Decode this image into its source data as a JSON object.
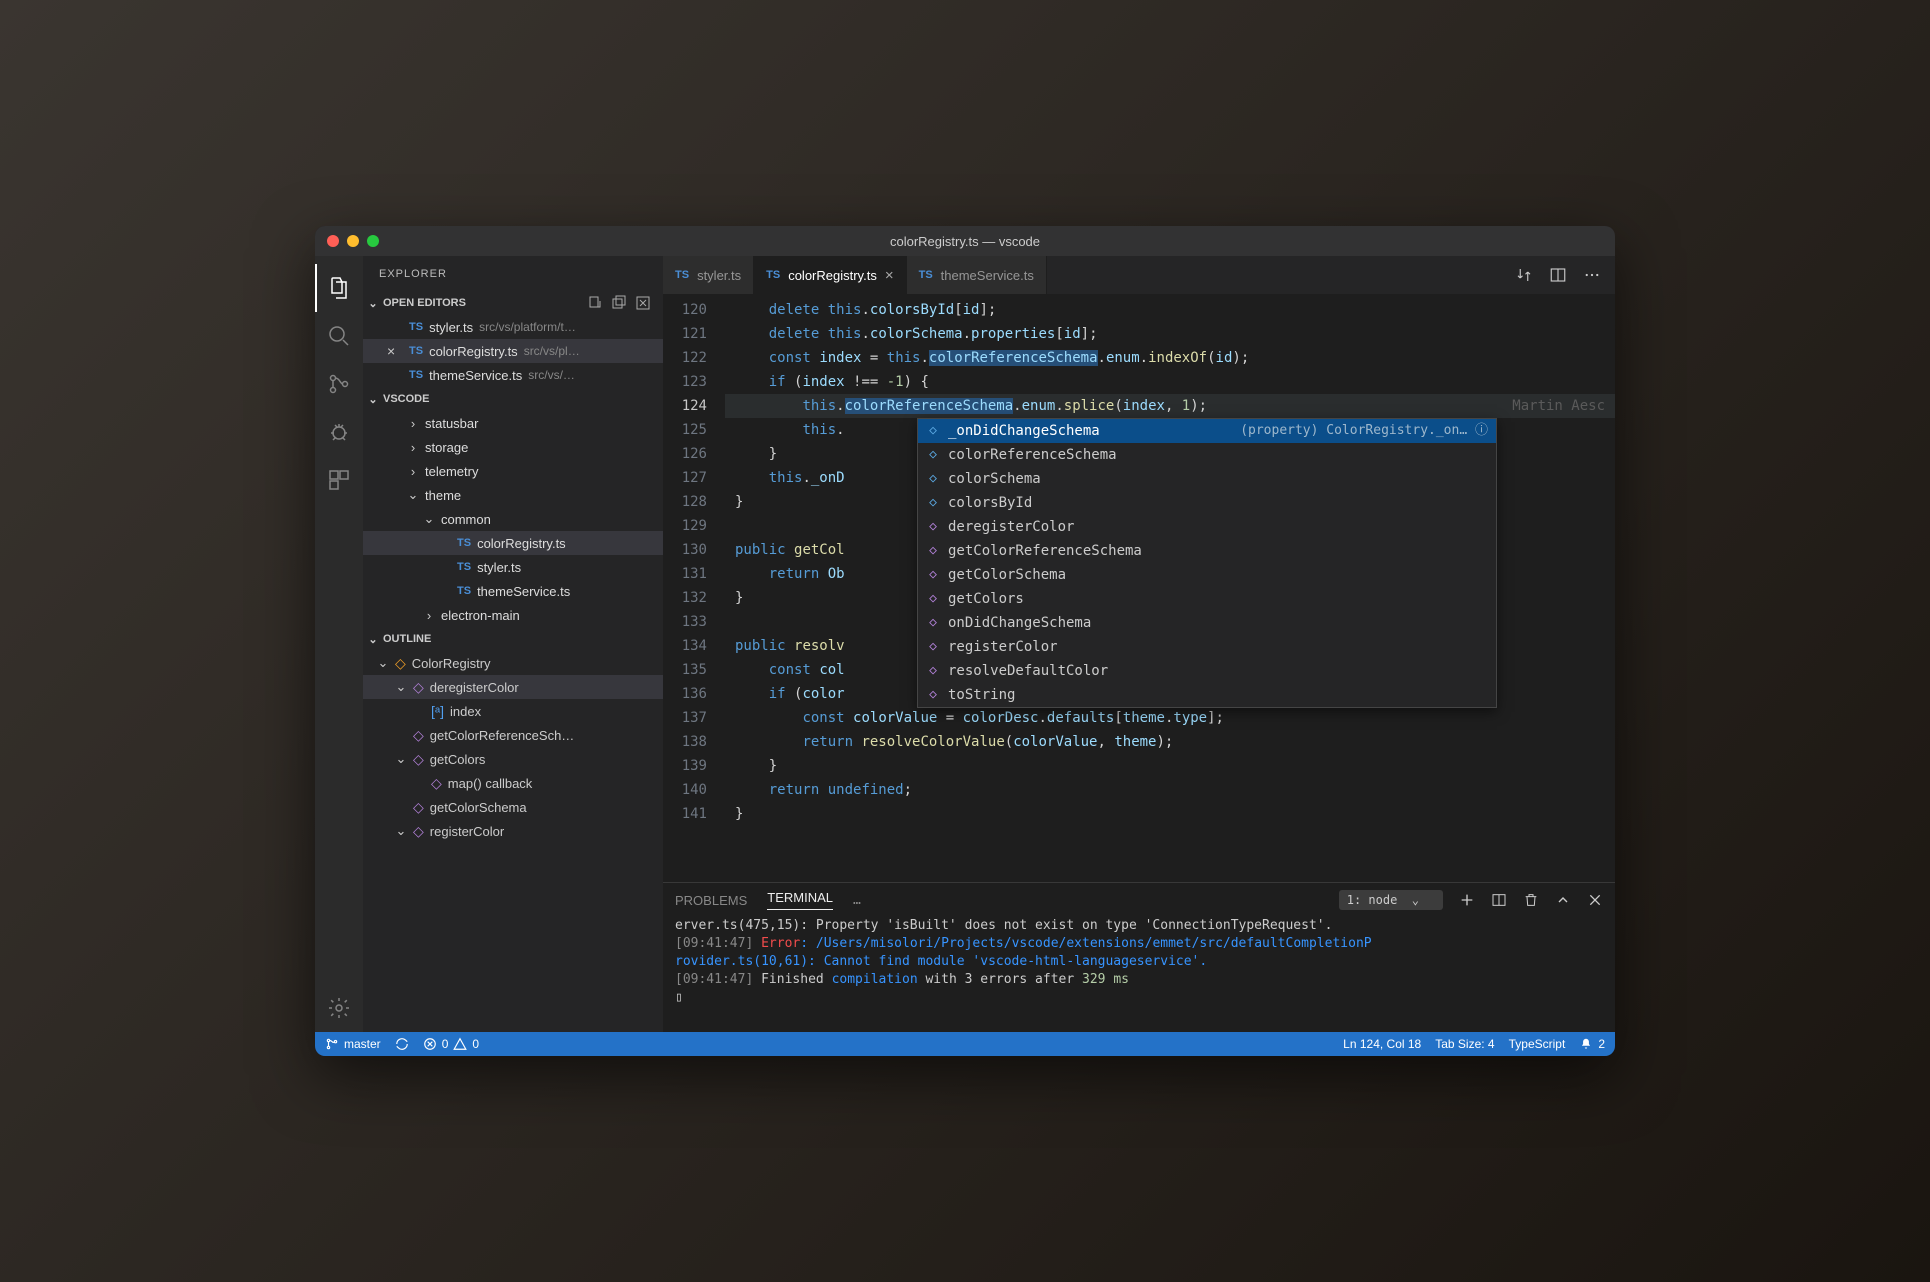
{
  "title": "colorRegistry.ts — vscode",
  "sidebar": {
    "title": "EXPLORER",
    "openEditors": {
      "label": "OPEN EDITORS",
      "items": [
        {
          "name": "styler.ts",
          "path": "src/vs/platform/t…",
          "active": false
        },
        {
          "name": "colorRegistry.ts",
          "path": "src/vs/pl…",
          "active": true
        },
        {
          "name": "themeService.ts",
          "path": "src/vs/…",
          "active": false
        }
      ]
    },
    "workspace": {
      "label": "VSCODE",
      "items": [
        {
          "indent": 2,
          "chev": ">",
          "name": "statusbar",
          "kind": "folder"
        },
        {
          "indent": 2,
          "chev": ">",
          "name": "storage",
          "kind": "folder"
        },
        {
          "indent": 2,
          "chev": ">",
          "name": "telemetry",
          "kind": "folder"
        },
        {
          "indent": 2,
          "chev": "v",
          "name": "theme",
          "kind": "folder"
        },
        {
          "indent": 3,
          "chev": "v",
          "name": "common",
          "kind": "folder"
        },
        {
          "indent": 4,
          "chev": "",
          "name": "colorRegistry.ts",
          "kind": "ts",
          "active": true
        },
        {
          "indent": 4,
          "chev": "",
          "name": "styler.ts",
          "kind": "ts"
        },
        {
          "indent": 4,
          "chev": "",
          "name": "themeService.ts",
          "kind": "ts"
        },
        {
          "indent": 3,
          "chev": ">",
          "name": "electron-main",
          "kind": "folder"
        }
      ]
    },
    "outline": {
      "label": "OUTLINE",
      "items": [
        {
          "indent": 0,
          "chev": "v",
          "name": "ColorRegistry",
          "kind": "class"
        },
        {
          "indent": 1,
          "chev": "v",
          "name": "deregisterColor",
          "kind": "method",
          "active": true
        },
        {
          "indent": 2,
          "chev": "",
          "name": "index",
          "kind": "var"
        },
        {
          "indent": 1,
          "chev": "",
          "name": "getColorReferenceSch…",
          "kind": "method"
        },
        {
          "indent": 1,
          "chev": "v",
          "name": "getColors",
          "kind": "method"
        },
        {
          "indent": 2,
          "chev": "",
          "name": "map() callback",
          "kind": "method"
        },
        {
          "indent": 1,
          "chev": "",
          "name": "getColorSchema",
          "kind": "method"
        },
        {
          "indent": 1,
          "chev": "v",
          "name": "registerColor",
          "kind": "method"
        }
      ]
    }
  },
  "tabs": [
    {
      "name": "styler.ts",
      "active": false
    },
    {
      "name": "colorRegistry.ts",
      "active": true,
      "close": true
    },
    {
      "name": "themeService.ts",
      "active": false
    }
  ],
  "lineStart": 120,
  "activeLine": 124,
  "blame": "Martin Aesc",
  "suggest": {
    "selected": {
      "label": "_onDidChangeSchema",
      "detail": "(property) ColorRegistry._on…"
    },
    "items": [
      {
        "label": "colorReferenceSchema",
        "kind": "prop"
      },
      {
        "label": "colorSchema",
        "kind": "prop"
      },
      {
        "label": "colorsById",
        "kind": "prop"
      },
      {
        "label": "deregisterColor",
        "kind": "method"
      },
      {
        "label": "getColorReferenceSchema",
        "kind": "method"
      },
      {
        "label": "getColorSchema",
        "kind": "method"
      },
      {
        "label": "getColors",
        "kind": "method"
      },
      {
        "label": "onDidChangeSchema",
        "kind": "method"
      },
      {
        "label": "registerColor",
        "kind": "method"
      },
      {
        "label": "resolveDefaultColor",
        "kind": "method"
      },
      {
        "label": "toString",
        "kind": "method"
      }
    ]
  },
  "panel": {
    "tabs": {
      "problems": "PROBLEMS",
      "terminal": "TERMINAL"
    },
    "select": "1: node",
    "lines": {
      "l1a": "erver.ts(475,15): Property 'isBuilt' does not exist on type 'ConnectionTypeRequest'.",
      "l2time": "[09:41:47]",
      "l2err": " Error",
      "l2path": ": /Users/misolori/Projects/vscode/extensions/emmet/src/defaultCompletionP",
      "l3": "rovider.ts(10,61): Cannot find module 'vscode-html-languageservice'.",
      "l4time": "[09:41:47]",
      "l4a": " Finished ",
      "l4b": "compilation",
      "l4c": " with 3 errors after ",
      "l4d": "329 ms"
    }
  },
  "status": {
    "branch": "master",
    "errors": "0",
    "warnings": "0",
    "lncol": "Ln 124, Col 18",
    "tabsize": "Tab Size: 4",
    "lang": "TypeScript",
    "bell": "2"
  }
}
